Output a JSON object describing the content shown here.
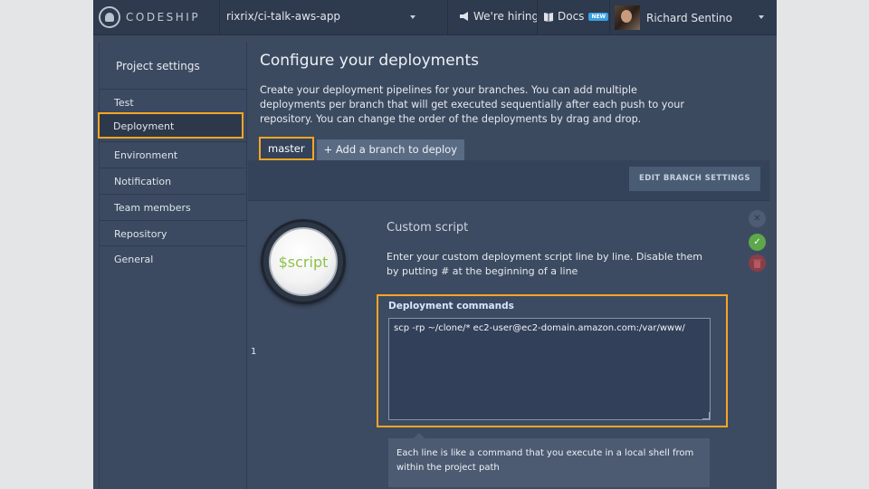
{
  "topbar": {
    "logo_text": "CODESHIP",
    "project": "rixrix/ci-talk-aws-app",
    "hiring": "We're hiring",
    "docs": "Docs",
    "docs_badge": "NEW",
    "user_name": "Richard Sentino"
  },
  "sidebar": {
    "title": "Project settings",
    "items": [
      {
        "label": "Test"
      },
      {
        "label": "Deployment"
      },
      {
        "label": "Environment"
      },
      {
        "label": "Notification"
      },
      {
        "label": "Team members"
      },
      {
        "label": "Repository"
      },
      {
        "label": "General"
      }
    ],
    "active_index": 1
  },
  "main": {
    "title": "Configure your deployments",
    "description": "Create your deployment pipelines for your branches. You can add multiple deployments per branch that will get executed sequentially after each push to your repository. You can change the order of the deployments by drag and drop.",
    "branch_tab": "master",
    "add_branch": "+ Add a branch to deploy",
    "edit_branch_settings": "EDIT BRANCH SETTINGS",
    "line_number": "1",
    "deployment": {
      "logo_text": "$script",
      "title": "Custom script",
      "description": "Enter your custom deployment script line by line. Disable them by putting # at the beginning of a line",
      "commands_label": "Deployment commands",
      "commands_value": "scp -rp ~/clone/* ec2-user@ec2-domain.amazon.com:/var/www/",
      "hint": "Each line is like a command that you execute in a local shell from within the project path"
    }
  },
  "colors": {
    "highlight": "#f6a623",
    "background": "#3c4a60",
    "topbar": "#2e3a4d",
    "success": "#5da84a",
    "danger": "#8a3e46"
  }
}
